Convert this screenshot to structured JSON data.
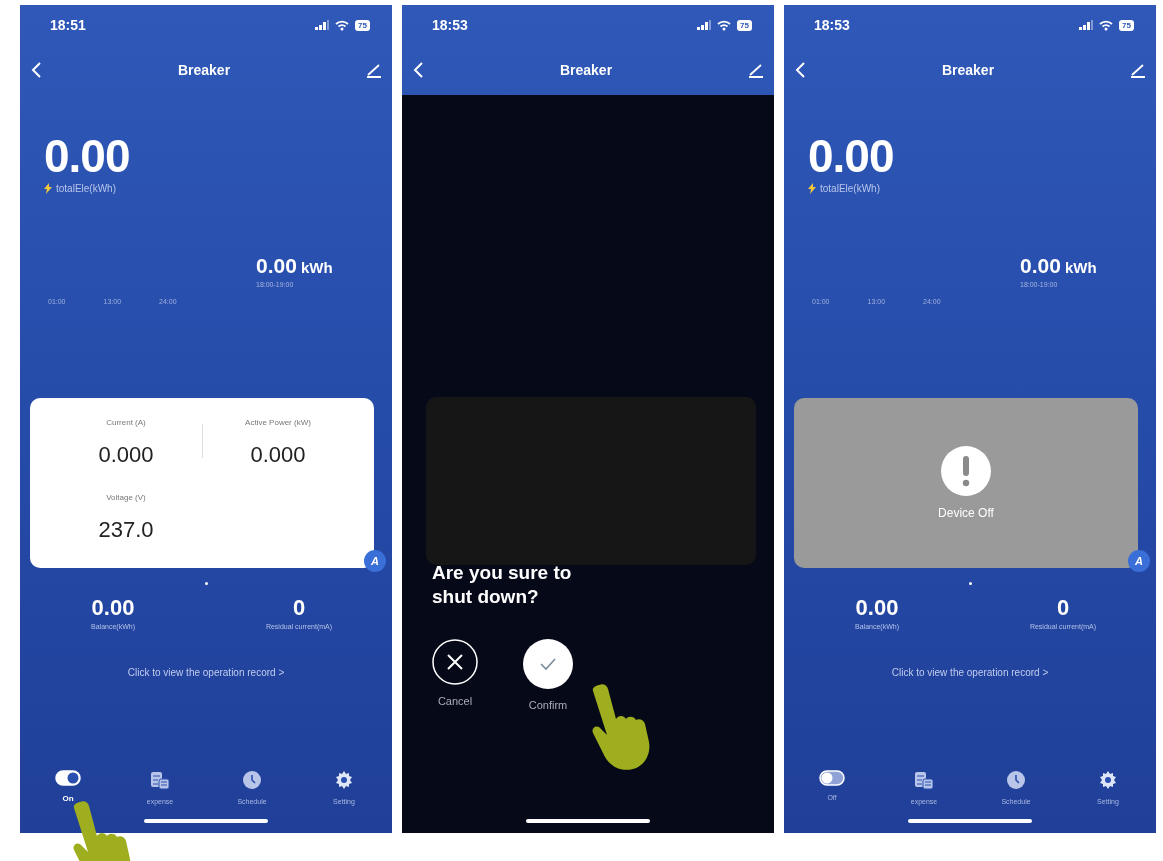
{
  "phones": [
    {
      "time": "18:51",
      "battery": "75",
      "title": "Breaker",
      "total": {
        "value": "0.00",
        "label": "totalEle(kWh)"
      },
      "hour": {
        "value": "0.00",
        "unit": "kWh",
        "range": "18:00-19:00"
      },
      "axis_labels": [
        "01:00",
        "13:00",
        "24:00"
      ],
      "card": {
        "kind": "readings",
        "readings": [
          {
            "label": "Current (A)",
            "value": "0.000"
          },
          {
            "label": "Active Power (kW)",
            "value": "0.000"
          },
          {
            "label": "Voltage (V)",
            "value": "237.0"
          }
        ],
        "badge": "A"
      },
      "stats": [
        {
          "value": "0.00",
          "label": "Balance(kWh)"
        },
        {
          "value": "0",
          "label": "Residual current(mA)"
        }
      ],
      "link": "Click to view the operation record >",
      "tabs": [
        {
          "kind": "switch",
          "on": true,
          "label": "On",
          "selected": true,
          "pointer": true
        },
        {
          "kind": "coins",
          "label": "expense",
          "selected": false
        },
        {
          "kind": "clock",
          "label": "Schedule",
          "selected": false
        },
        {
          "kind": "gear",
          "label": "Setting",
          "selected": false
        }
      ]
    },
    {
      "time": "18:53",
      "battery": "75",
      "title": "Breaker",
      "dialog": {
        "question": "Are you sure to shut down?",
        "cancel": "Cancel",
        "confirm": "Confirm",
        "confirm_pointer": true
      }
    },
    {
      "time": "18:53",
      "battery": "75",
      "title": "Breaker",
      "total": {
        "value": "0.00",
        "label": "totalEle(kWh)"
      },
      "hour": {
        "value": "0.00",
        "unit": "kWh",
        "range": "18:00-19:00"
      },
      "axis_labels": [
        "01:00",
        "13:00",
        "24:00"
      ],
      "card": {
        "kind": "off",
        "message": "Device Off",
        "badge": "A"
      },
      "stats": [
        {
          "value": "0.00",
          "label": "Balance(kWh)"
        },
        {
          "value": "0",
          "label": "Residual current(mA)"
        }
      ],
      "link": "Click to view the operation record >",
      "tabs": [
        {
          "kind": "switch",
          "on": false,
          "label": "Off",
          "selected": false
        },
        {
          "kind": "coins",
          "label": "expense",
          "selected": false
        },
        {
          "kind": "clock",
          "label": "Schedule",
          "selected": false
        },
        {
          "kind": "gear",
          "label": "Setting",
          "selected": false
        }
      ]
    }
  ]
}
